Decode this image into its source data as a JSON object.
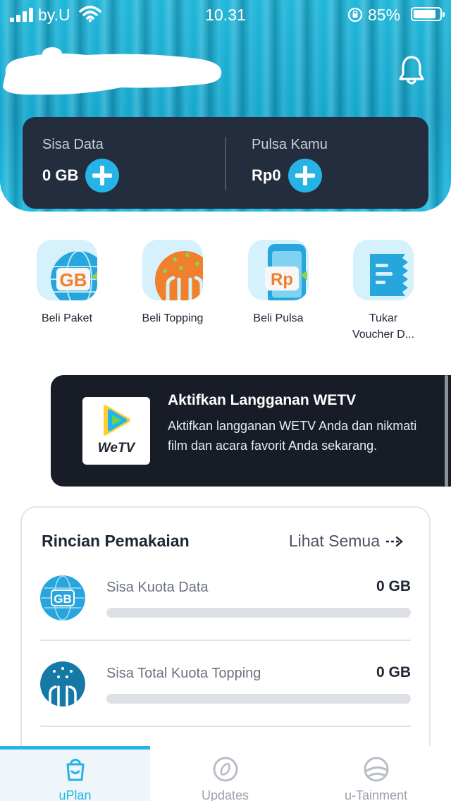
{
  "status_bar": {
    "carrier": "by.U",
    "time": "10.31",
    "battery": "85%",
    "battery_level": 0.85
  },
  "balance": {
    "data_label": "Sisa Data",
    "data_value": "0 GB",
    "credit_label": "Pulsa Kamu",
    "credit_value": "Rp0"
  },
  "quick_actions": [
    {
      "label": "Beli Paket",
      "icon": "gb-globe-icon"
    },
    {
      "label": "Beli Topping",
      "icon": "topping-icon"
    },
    {
      "label": "Beli Pulsa",
      "icon": "rp-phone-icon"
    },
    {
      "label": "Tukar\nVoucher D...",
      "icon": "voucher-icon"
    }
  ],
  "banner": {
    "title": "Aktifkan Langganan WETV",
    "description": "Aktifkan langganan WETV Anda dan nikmati film dan acara favorit Anda sekarang.",
    "logo_text": "WeTV"
  },
  "usage": {
    "title": "Rincian Pemakaian",
    "see_all": "Lihat Semua",
    "items": [
      {
        "name": "Sisa Kuota Data",
        "value": "0 GB",
        "level": 0
      },
      {
        "name": "Sisa Total Kuota Topping",
        "value": "0 GB",
        "level": 0
      }
    ]
  },
  "nav": {
    "tabs": [
      {
        "label": "uPlan",
        "active": true
      },
      {
        "label": "Updates",
        "active": false
      },
      {
        "label": "u-Tainment",
        "active": false
      }
    ]
  },
  "colors": {
    "accent": "#26b3e6",
    "dark_card": "#232d3d",
    "banner_bg": "#171c26",
    "inactive_nav": "#9aa1ab"
  }
}
